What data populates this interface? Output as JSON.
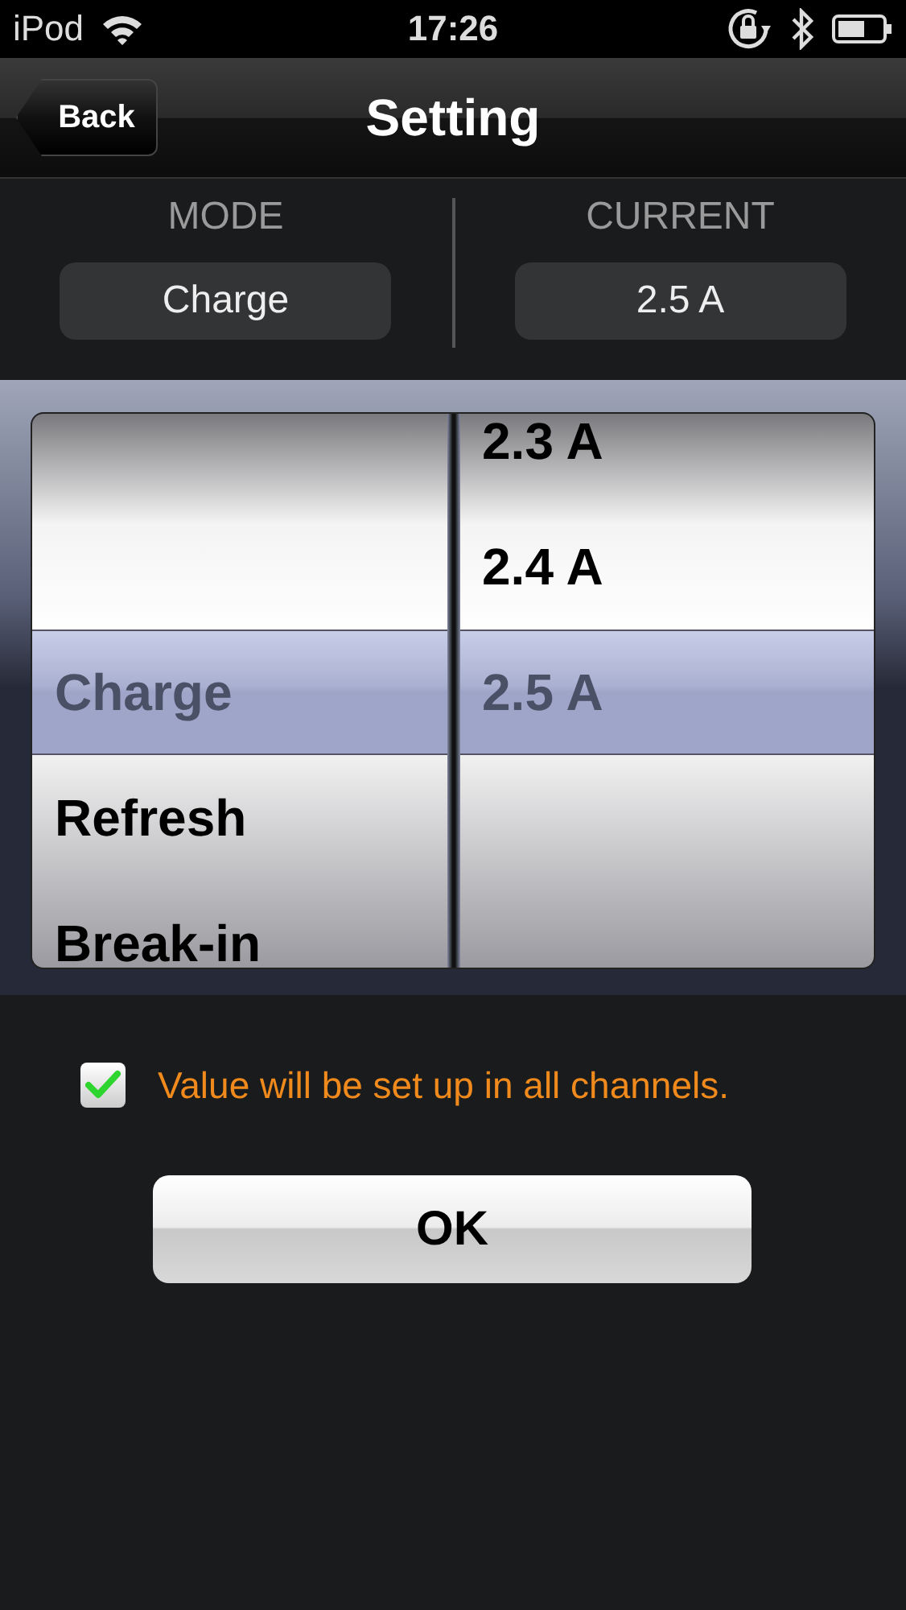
{
  "status_bar": {
    "carrier": "iPod",
    "time": "17:26"
  },
  "nav_bar": {
    "back": "Back",
    "title": "Setting"
  },
  "summary": [
    {
      "label": "MODE",
      "value": "Charge"
    },
    {
      "label": "CURRENT",
      "value": "2.5 A"
    }
  ],
  "picker": {
    "columns": [
      {
        "items": [
          {
            "label": "Charge",
            "selected": true
          },
          {
            "label": "Refresh",
            "selected": false
          },
          {
            "label": "Break-in",
            "selected": false
          }
        ]
      },
      {
        "items": [
          {
            "label": "2.3 A",
            "selected": false
          },
          {
            "label": "2.4 A",
            "selected": false
          },
          {
            "label": "2.5 A",
            "selected": true
          }
        ]
      }
    ]
  },
  "apply_all": {
    "label": "Value will be set up in all channels.",
    "checked": true
  },
  "ok_button": "OK"
}
